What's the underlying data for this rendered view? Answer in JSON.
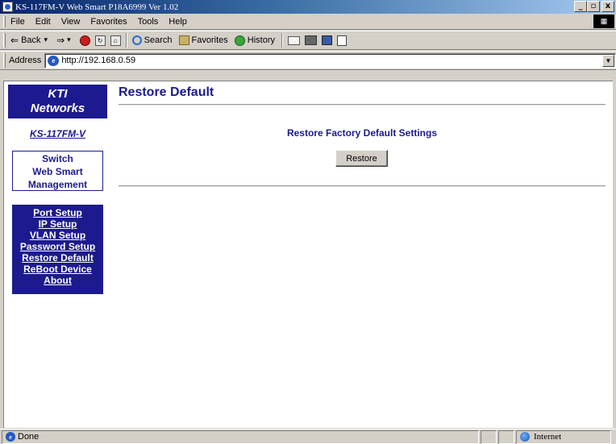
{
  "window": {
    "title": "KS-117FM-V Web Smart P18A6999 Ver 1.02",
    "minimize": "_",
    "maximize": "ı",
    "close": "x"
  },
  "menu": {
    "items": [
      "File",
      "Edit",
      "View",
      "Favorites",
      "Tools",
      "Help"
    ]
  },
  "toolbar": {
    "back_label": "Back",
    "search_label": "Search",
    "favorites_label": "Favorites",
    "history_label": "History"
  },
  "address": {
    "label": "Address",
    "url": "http://192.168.0.59"
  },
  "sidebar": {
    "brand_line1": "KTI",
    "brand_line2": "Networks",
    "model": "KS-117FM-V",
    "mgmt_line1": "Switch",
    "mgmt_line2": "Web Smart",
    "mgmt_line3": "Management",
    "nav": [
      "Port Setup",
      "IP Setup",
      "VLAN Setup",
      "Password Setup",
      "Restore Default",
      "ReBoot Device",
      "About"
    ]
  },
  "main": {
    "title": "Restore Default",
    "subtitle": "Restore Factory Default Settings",
    "button_label": "Restore"
  },
  "status": {
    "text": "Done",
    "zone": "Internet"
  },
  "colors": {
    "accent": "#1c1a8e",
    "chrome": "#d4d0c8"
  }
}
